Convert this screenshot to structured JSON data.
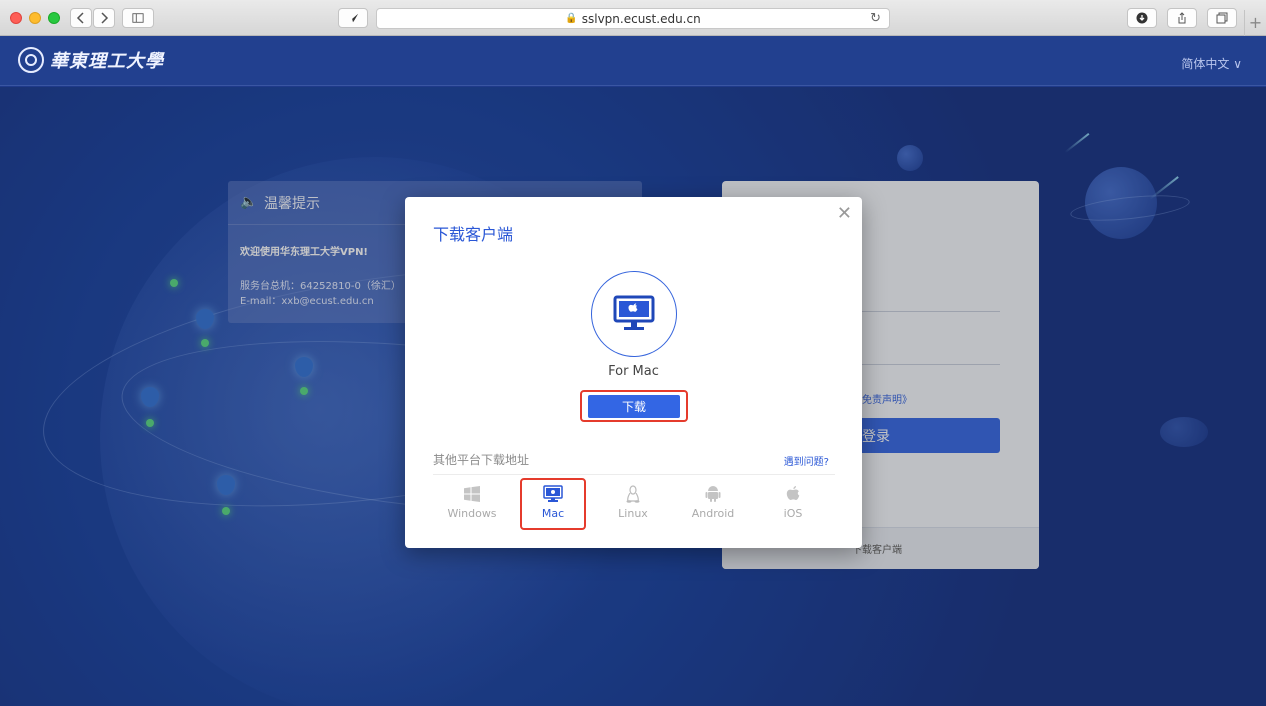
{
  "browser": {
    "url": "sslvpn.ecust.edu.cn",
    "icons": [
      "back-icon",
      "forward-icon",
      "sidebar-icon",
      "bird-icon",
      "lock-icon",
      "reload-icon",
      "download-icon",
      "share-icon",
      "tabs-icon",
      "new-tab-icon"
    ]
  },
  "header": {
    "logo_text": "華東理工大學",
    "language": "简体中文 ∨"
  },
  "notice": {
    "title": "温馨提示",
    "welcome": "欢迎使用华东理工大学VPN!",
    "phone": "服务台总机：64252810-0（徐汇）",
    "email": "E-mail：xxb@ecust.edu.cn"
  },
  "login": {
    "disclaimer": "《免责声明》",
    "button": "登录",
    "download_link": "下载客户端"
  },
  "modal": {
    "title": "下载客户端",
    "os_name": "For Mac",
    "download_button": "下载",
    "other_label": "其他平台下载地址",
    "help_link": "遇到问题?",
    "platforms": [
      {
        "label": "Windows",
        "icon": "windows-icon",
        "active": false
      },
      {
        "label": "Mac",
        "icon": "monitor-icon",
        "active": true
      },
      {
        "label": "Linux",
        "icon": "linux-icon",
        "active": false
      },
      {
        "label": "Android",
        "icon": "android-icon",
        "active": false
      },
      {
        "label": "iOS",
        "icon": "apple-icon",
        "active": false
      }
    ]
  },
  "colors": {
    "accent": "#3366e4",
    "highlight": "#e53b2c",
    "page_bg": "#1f3a8a"
  }
}
